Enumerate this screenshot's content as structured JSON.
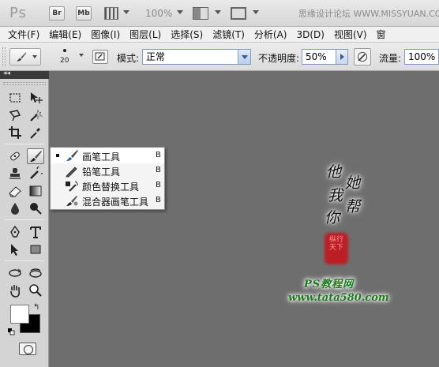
{
  "app": {
    "logo": "Ps",
    "launch_bridge": "Br",
    "launch_minibridge": "Mb",
    "zoom": "100%",
    "watermark_site": "思缘设计论坛 WWW.MISSYUAN.COM"
  },
  "menu": [
    "文件(F)",
    "编辑(E)",
    "图像(I)",
    "图层(L)",
    "选择(S)",
    "滤镜(T)",
    "分析(A)",
    "3D(D)",
    "视图(V)",
    "窗"
  ],
  "options": {
    "brush_size": "20",
    "mode_label": "模式:",
    "mode_value": "正常",
    "opacity_label": "不透明度:",
    "opacity_value": "50%",
    "flow_label": "流量:",
    "flow_value": "100%"
  },
  "toolbox": {
    "collapse": "◂◂",
    "foreground_color": "#ffffff",
    "background_color": "#000000"
  },
  "flyout": {
    "items": [
      {
        "label": "画笔工具",
        "key": "B",
        "selected": true,
        "icon": "brush-icon"
      },
      {
        "label": "铅笔工具",
        "key": "B",
        "selected": false,
        "icon": "pencil-icon"
      },
      {
        "label": "颜色替换工具",
        "key": "B",
        "selected": false,
        "icon": "color-replacement-icon"
      },
      {
        "label": "混合器画笔工具",
        "key": "B",
        "selected": false,
        "icon": "mixer-brush-icon"
      }
    ]
  },
  "canvas": {
    "calligraphy": [
      "他",
      "她",
      "我",
      "帮",
      "你"
    ],
    "seal_text": "纵行天下",
    "watermark_line1": "PS教程网",
    "watermark_line2": "www.tata580.com"
  }
}
